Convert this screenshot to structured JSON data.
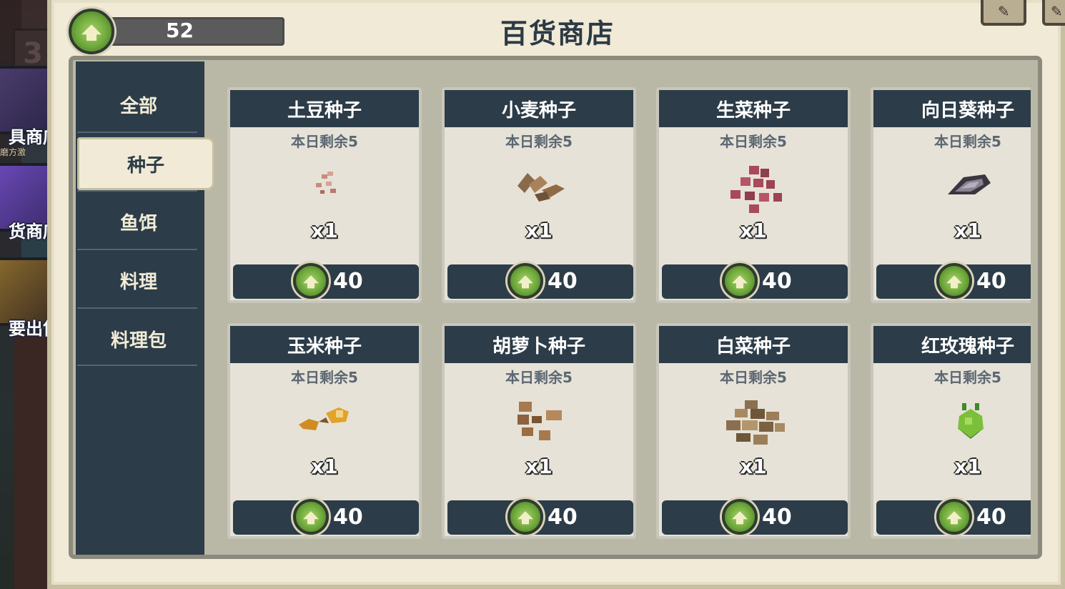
{
  "header": {
    "title": "百货商店",
    "currency_amount": "52",
    "currency_icon": "green-leaf-coin-icon"
  },
  "side_nav": {
    "level": "3",
    "shops": [
      {
        "label": "具商店",
        "sub": "磨方激"
      },
      {
        "label": "货商店"
      },
      {
        "label": "要出售"
      }
    ]
  },
  "categories": [
    {
      "label": "全部",
      "active": false
    },
    {
      "label": "种子",
      "active": true
    },
    {
      "label": "鱼饵",
      "active": false
    },
    {
      "label": "料理",
      "active": false
    },
    {
      "label": "料理包",
      "active": false
    }
  ],
  "items": [
    {
      "name": "土豆种子",
      "remaining": "本日剩余5",
      "quantity": "x1",
      "price": "40",
      "icon": "potato-seed-icon"
    },
    {
      "name": "小麦种子",
      "remaining": "本日剩余5",
      "quantity": "x1",
      "price": "40",
      "icon": "wheat-seed-icon"
    },
    {
      "name": "生菜种子",
      "remaining": "本日剩余5",
      "quantity": "x1",
      "price": "40",
      "icon": "lettuce-seed-icon"
    },
    {
      "name": "向日葵种子",
      "remaining": "本日剩余5",
      "quantity": "x1",
      "price": "40",
      "icon": "sunflower-seed-icon"
    },
    {
      "name": "玉米种子",
      "remaining": "本日剩余5",
      "quantity": "x1",
      "price": "40",
      "icon": "corn-seed-icon"
    },
    {
      "name": "胡萝卜种子",
      "remaining": "本日剩余5",
      "quantity": "x1",
      "price": "40",
      "icon": "carrot-seed-icon"
    },
    {
      "name": "白菜种子",
      "remaining": "本日剩余5",
      "quantity": "x1",
      "price": "40",
      "icon": "cabbage-seed-icon"
    },
    {
      "name": "红玫瑰种子",
      "remaining": "本日剩余5",
      "quantity": "x1",
      "price": "40",
      "icon": "rose-seed-icon"
    }
  ],
  "colors": {
    "panel_bg": "#f0ead7",
    "dark_navy": "#2c3c48",
    "coin_green": "#6ea83a"
  }
}
